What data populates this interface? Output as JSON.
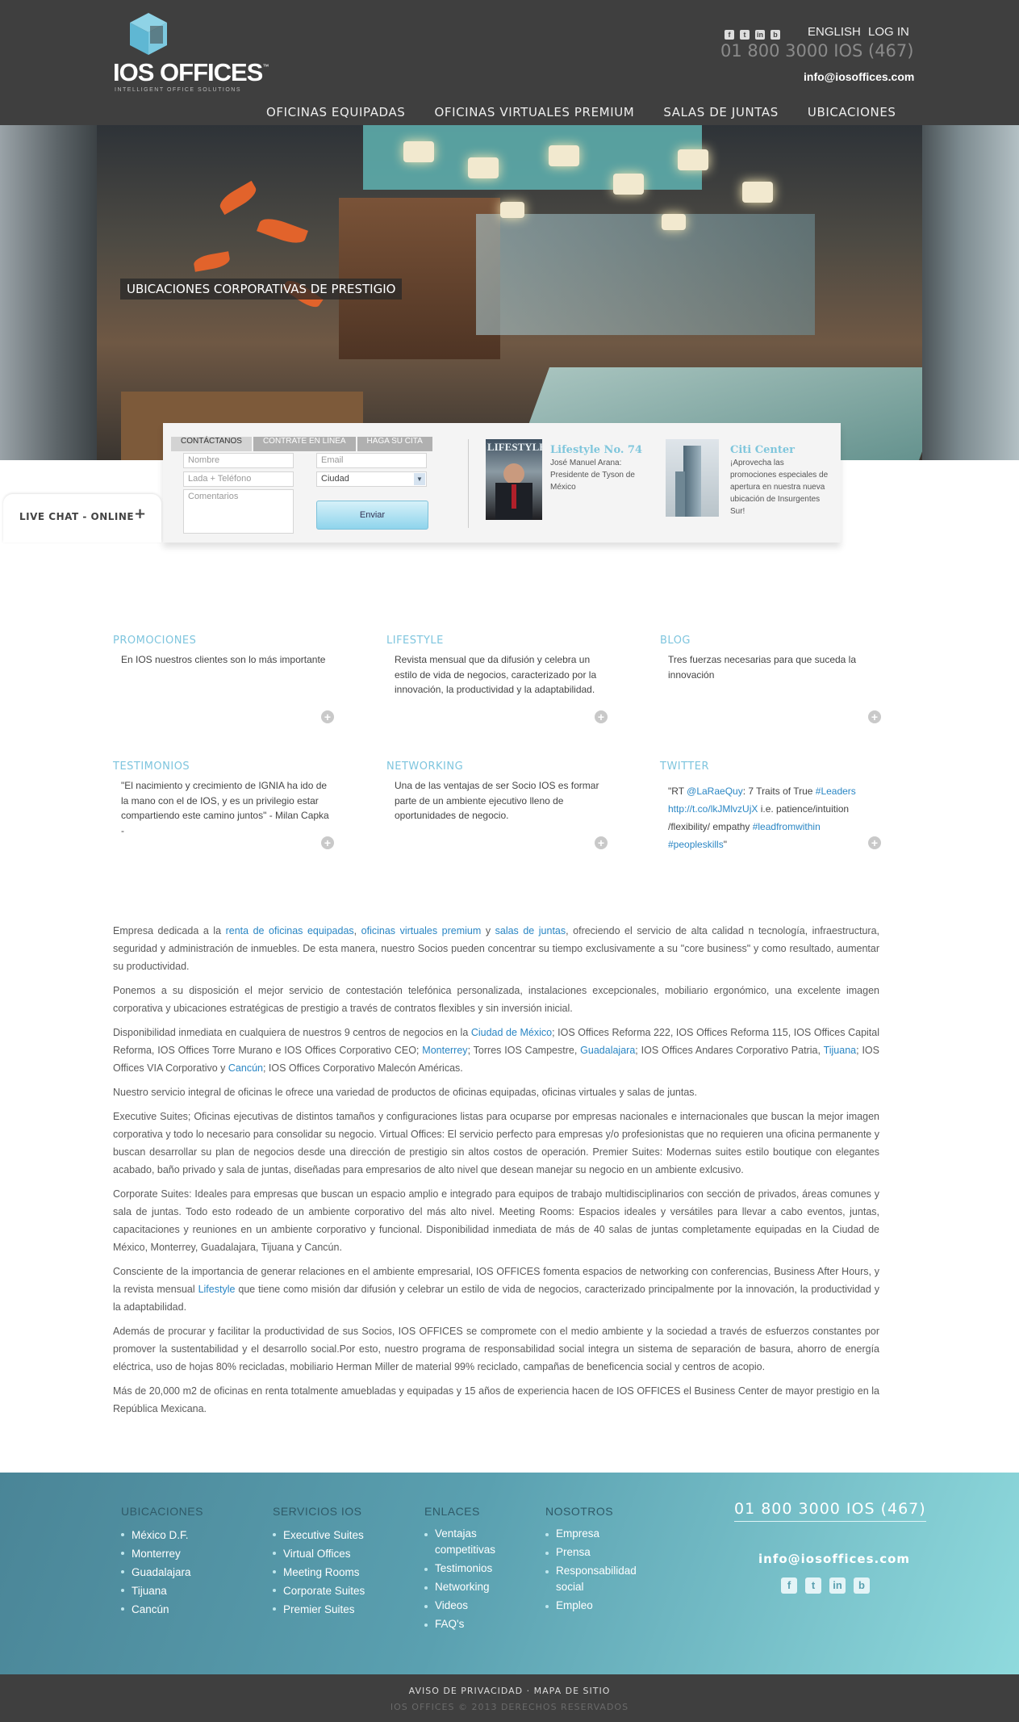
{
  "brand": {
    "name": "IOS OFFICES",
    "trademark": "™",
    "tagline": "INTELLIGENT OFFICE SOLUTIONS"
  },
  "header": {
    "social_icons": [
      "facebook-icon",
      "twitter-icon",
      "linkedin-icon",
      "blog-icon"
    ],
    "language": "ENGLISH",
    "login": "LOG IN",
    "phone": "01 800 3000 IOS (467)",
    "email": "info@iosoffices.com"
  },
  "nav": {
    "items": [
      "OFICINAS EQUIPADAS",
      "OFICINAS VIRTUALES PREMIUM",
      "SALAS DE JUNTAS",
      "UBICACIONES"
    ]
  },
  "hero": {
    "caption": "UBICACIONES CORPORATIVAS DE PRESTIGIO"
  },
  "contact": {
    "tabs": [
      "CONTÁCTANOS",
      "CONTRATE EN LÍNEA",
      "HAGA SU CITA"
    ],
    "placeholders": {
      "nombre": "Nombre",
      "lada": "Lada + Teléfono",
      "comentarios": "Comentarios",
      "email": "Email"
    },
    "ciudad": "Ciudad",
    "send": "Enviar"
  },
  "promos": [
    {
      "title": "Lifestyle No. 74",
      "text": "José Manuel Arana: Presidente de Tyson de México",
      "thumb_word": "LIFESTYLE"
    },
    {
      "title": "Citi Center",
      "text": "¡Aprovecha las promociones especiales de apertura en nuestra nueva ubicación de Insurgentes Sur!"
    }
  ],
  "livechat": {
    "label": "LIVE CHAT - ONLINE",
    "plus": "+"
  },
  "features": [
    {
      "title": "PROMOCIONES",
      "text": "En IOS nuestros clientes son lo más importante"
    },
    {
      "title": "LIFESTYLE",
      "text": "Revista mensual que da difusión y celebra un estilo de vida de negocios, caracterizado por la innovación, la productividad y la adaptabilidad."
    },
    {
      "title": "BLOG",
      "text": "Tres fuerzas necesarias para que suceda la innovación"
    },
    {
      "title": "TESTIMONIOS",
      "text": "\"El nacimiento y crecimiento de IGNIA ha ido de la mano con el de IOS, y es un privilegio estar compartiendo este camino juntos\" - Milan Capka -"
    },
    {
      "title": "NETWORKING",
      "text": "Una de las ventajas de ser Socio IOS es formar parte de un ambiente ejecutivo lleno de oportunidades de negocio."
    },
    {
      "title": "TWITTER",
      "tweet": {
        "prefix": "\"RT ",
        "mention": "@LaRaeQuy",
        "mid": ": 7 Traits of True ",
        "hashtag1": "#Leaders",
        "link": "http://t.co/lkJMlvzUjX",
        "after_link": " i.e. patience/intuition /flexibility/ empathy ",
        "hashtag2": "#leadfromwithin",
        "hashtag3": "#peopleskills",
        "suffix": "\""
      }
    }
  ],
  "about": {
    "p1": {
      "a": "Empresa dedicada a la ",
      "l1": "renta de oficinas equipadas",
      "b": ", ",
      "l2": "oficinas virtuales premium",
      "c": " y ",
      "l3": "salas de juntas",
      "d": ", ofreciendo el servicio de alta calidad n tecnología, infraestructura, seguridad y administración de inmuebles. De esta manera, nuestro Socios pueden concentrar su tiempo exclusivamente a su \"core business\" y como resultado, aumentar su productividad."
    },
    "p2": "Ponemos a su disposición el mejor servicio de contestación telefónica personalizada, instalaciones excepcionales, mobiliario ergonómico, una excelente imagen corporativa y ubicaciones estratégicas de prestigio a través de contratos flexibles y sin inversión inicial.",
    "p3": {
      "a": "Disponibilidad inmediata en cualquiera de nuestros 9 centros de negocios en la ",
      "l1": "Ciudad de México",
      "b": "; IOS Offices Reforma 222, IOS Offices Reforma 115, IOS Offices Capital Reforma, IOS Offices Torre Murano e IOS Offices Corporativo CEO; ",
      "l2": "Monterrey",
      "c": "; Torres IOS Campestre, ",
      "l3": "Guadalajara",
      "d": "; IOS Offices Andares Corporativo Patria, ",
      "l4": "Tijuana",
      "e": "; IOS Offices VIA Corporativo y ",
      "l5": "Cancún",
      "f": "; IOS Offices Corporativo Malecón Américas."
    },
    "p4": "Nuestro servicio integral de oficinas le ofrece una variedad de productos de oficinas equipadas, oficinas virtuales y salas de juntas.",
    "p5": "Executive Suites; Oficinas ejecutivas de distintos tamaños y configuraciones listas para ocuparse por empresas nacionales e internacionales que buscan la mejor imagen corporativa y todo lo necesario para consolidar su negocio. Virtual Offices: El servicio perfecto para empresas y/o profesionistas que no requieren una oficina permanente y buscan desarrollar su plan de negocios desde una dirección de prestigio sin altos costos de operación. Premier Suites: Modernas suites estilo boutique con elegantes acabado, baño privado y sala de juntas, diseñadas para empresarios de alto nivel que desean manejar su negocio en un ambiente exlcusivo.",
    "p6": "Corporate Suites: Ideales para empresas que buscan un espacio amplio e integrado para equipos de trabajo multidisciplinarios con sección de privados, áreas comunes y sala de juntas. Todo esto rodeado de un ambiente corporativo del más alto nivel. Meeting Rooms: Espacios ideales y versátiles para llevar a cabo eventos, juntas, capacitaciones y reuniones en un ambiente corporativo y funcional. Disponibilidad inmediata de más de 40 salas de juntas completamente equipadas en la Ciudad de México, Monterrey, Guadalajara, Tijuana y Cancún.",
    "p7": {
      "a": "Consciente de la importancia de generar relaciones en el ambiente empresarial, IOS OFFICES fomenta espacios de networking con conferencias, Business After Hours, y la revista mensual ",
      "l1": "Lifestyle",
      "b": " que tiene como misión dar difusión y celebrar un estilo de vida de negocios, caracterizado principalmente por la innovación, la productividad y la adaptabilidad."
    },
    "p8": "Además de procurar y facilitar la productividad de sus Socios, IOS OFFICES se compromete con el medio ambiente y la sociedad a través de esfuerzos constantes por promover la sustentabilidad y el desarrollo social.Por esto, nuestro programa de responsabilidad social integra un sistema de separación de basura, ahorro de energía eléctrica, uso de hojas 80% recicladas, mobiliario Herman Miller de material 99% reciclado, campañas de beneficencia social y centros de acopio.",
    "p9": "Más de 20,000 m2 de oficinas en renta totalmente amuebladas y equipadas y 15 años de experiencia hacen de IOS OFFICES el Business Center de mayor prestigio en la República Mexicana."
  },
  "footer": {
    "columns": [
      {
        "title": "UBICACIONES",
        "items": [
          "México D.F.",
          "Monterrey",
          "Guadalajara",
          "Tijuana",
          "Cancún"
        ]
      },
      {
        "title": "SERVICIOS IOS",
        "items": [
          "Executive Suites",
          "Virtual Offices",
          "Meeting Rooms",
          "Corporate Suites",
          "Premier Suites"
        ]
      },
      {
        "title": "ENLACES",
        "items": [
          "Ventajas competitivas",
          "Testimonios",
          "Networking",
          "Videos",
          "FAQ's"
        ]
      },
      {
        "title": "NOSOTROS",
        "items": [
          "Empresa",
          "Prensa",
          "Responsabilidad social",
          "Empleo"
        ]
      }
    ],
    "phone": "01 800 3000 IOS (467)",
    "email": "info@iosoffices.com",
    "social_icons": [
      "facebook-icon",
      "twitter-icon",
      "linkedin-icon",
      "blog-icon"
    ],
    "legal": "AVISO DE PRIVACIDAD · MAPA DE SITIO",
    "copyright": "IOS OFFICES © 2013 DERECHOS RESERVADOS"
  },
  "colors": {
    "header_bg": "#3f3f3f",
    "accent_blue": "#7ec5de",
    "link_blue": "#2a86c4",
    "footer_teal": "#5aa0b0"
  }
}
